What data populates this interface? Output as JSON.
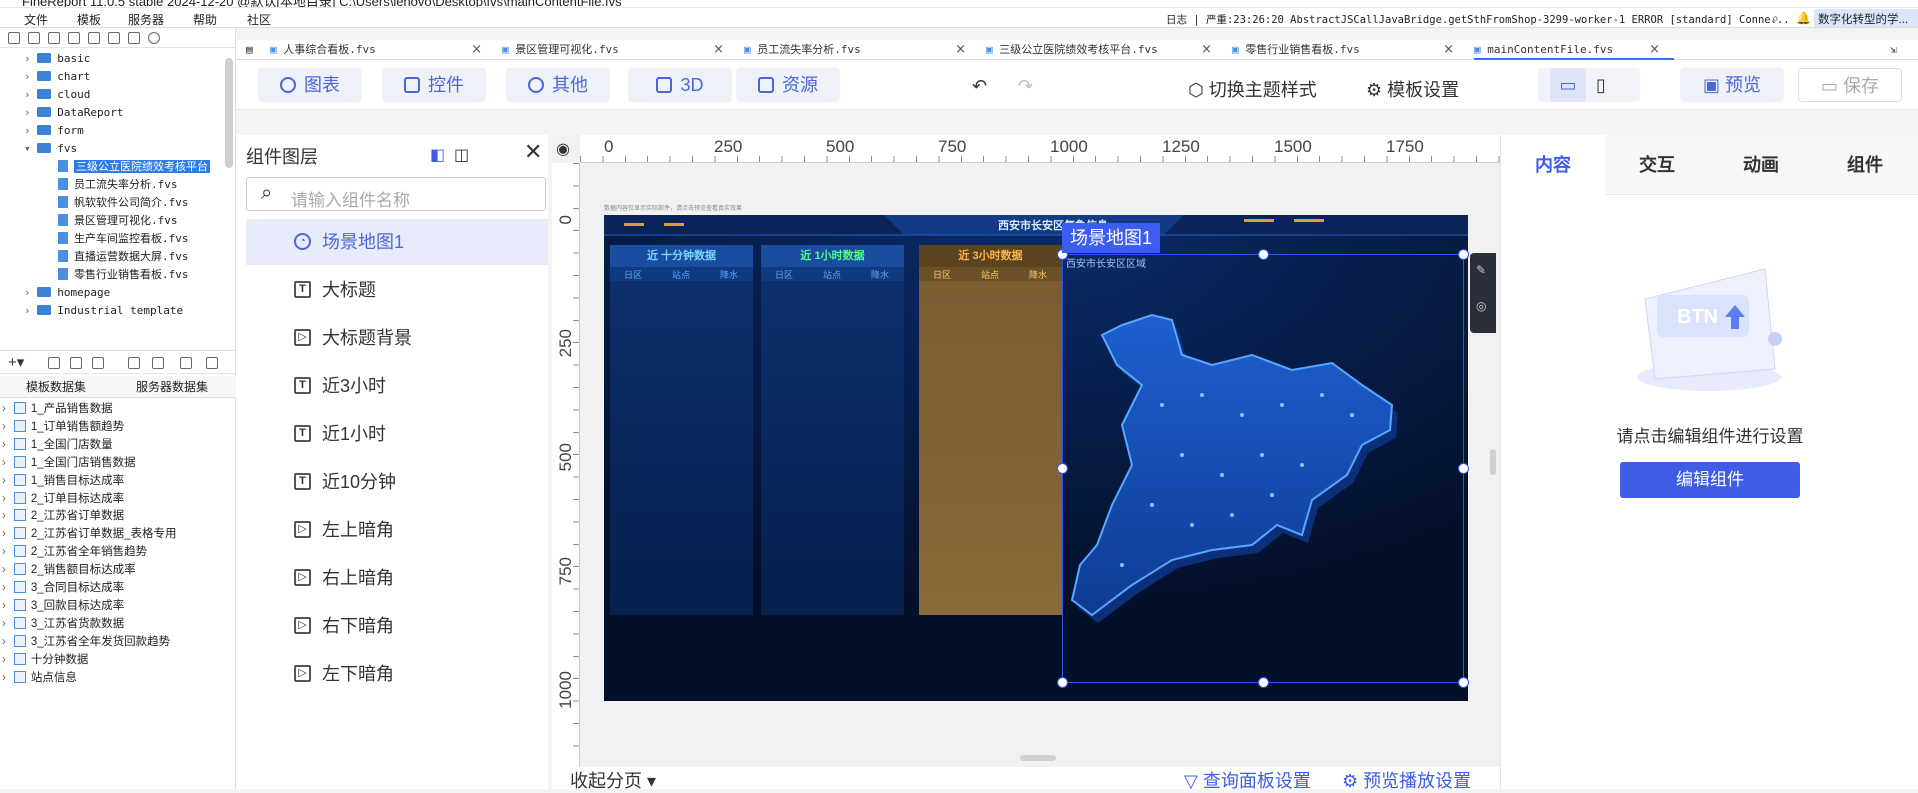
{
  "window": {
    "title": "FineReport 11.0.5 stable 2024-12-20 @默认[本地目录]    C:\\Users\\lenovo\\Desktop\\fvs\\mainContentFile.fvs"
  },
  "menu": {
    "items": [
      "文件",
      "模板",
      "服务器",
      "帮助",
      "社区"
    ],
    "log": "日志 | 严重:23:26:20 AbstractJSCallJavaBridge.getSthFromShop-3299-worker-1 ERROR [standard] Conne...",
    "tag": "数字化转型的学..."
  },
  "tree": {
    "items": [
      {
        "label": "basic",
        "type": "folder",
        "level": 1
      },
      {
        "label": "chart",
        "type": "folder",
        "level": 1
      },
      {
        "label": "cloud",
        "type": "folder",
        "level": 1
      },
      {
        "label": "DataReport",
        "type": "folder",
        "level": 1
      },
      {
        "label": "form",
        "type": "folder",
        "level": 1
      },
      {
        "label": "fvs",
        "type": "folder",
        "level": 1
      },
      {
        "label": "三级公立医院绩效考核平台",
        "type": "file",
        "level": 2,
        "selected": true
      },
      {
        "label": "员工流失率分析.fvs",
        "type": "file",
        "level": 2
      },
      {
        "label": "帆软软件公司简介.fvs",
        "type": "file",
        "level": 2
      },
      {
        "label": "景区管理可视化.fvs",
        "type": "file",
        "level": 2
      },
      {
        "label": "生产车间监控看板.fvs",
        "type": "file",
        "level": 2
      },
      {
        "label": "直播运营数据大屏.fvs",
        "type": "file",
        "level": 2
      },
      {
        "label": "零售行业销售看板.fvs",
        "type": "file",
        "level": 2
      },
      {
        "label": "homepage",
        "type": "folder",
        "level": 1
      },
      {
        "label": "Industrial template",
        "type": "folder",
        "level": 1
      }
    ]
  },
  "datasets": {
    "tabs": [
      "模板数据集",
      "服务器数据集"
    ],
    "items": [
      "1_产品销售数据",
      "1_订单销售额趋势",
      "1_全国门店数量",
      "1_全国门店销售数据",
      "1_销售目标达成率",
      "2_订单目标达成率",
      "2_江苏省订单数据",
      "2_江苏省订单数据_表格专用",
      "2_江苏省全年销售趋势",
      "2_销售额目标达成率",
      "3_合同目标达成率",
      "3_回款目标达成率",
      "3_江苏省货款数据",
      "3_江苏省全年发货回款趋势",
      "十分钟数据",
      "站点信息"
    ]
  },
  "doctabs": [
    {
      "label": "人事综合看板.fvs"
    },
    {
      "label": "景区管理可视化.fvs"
    },
    {
      "label": "员工流失率分析.fvs"
    },
    {
      "label": "三级公立医院绩效考核平台.fvs"
    },
    {
      "label": "零售行业销售看板.fvs"
    },
    {
      "label": "mainContentFile.fvs",
      "active": true
    }
  ],
  "toolbar": {
    "chart": "图表",
    "widget": "控件",
    "other": "其他",
    "three_d": "3D",
    "resource": "资源",
    "switch_theme": "切换主题样式",
    "template_settings": "模板设置",
    "preview": "预览",
    "save": "保存"
  },
  "layers": {
    "title": "组件图层",
    "search_placeholder": "请输入组件名称",
    "items": [
      "场景地图1",
      "大标题",
      "大标题背景",
      "近3小时",
      "近1小时",
      "近10分钟",
      "左上暗角",
      "右上暗角",
      "右下暗角",
      "左下暗角"
    ]
  },
  "ruler": {
    "h": [
      "0",
      "250",
      "500",
      "750",
      "1000",
      "1250",
      "1500",
      "1750"
    ],
    "v": [
      "0",
      "250",
      "500",
      "750",
      "1000"
    ]
  },
  "canvas": {
    "title": "西安市长安区气象信息",
    "map_sub": "西安市长安区区域",
    "tiny": "数据内容仅显示实际部件，请点击预览查看真实效果",
    "panels": [
      {
        "title": "近 十分钟数据",
        "cols": [
          "日区",
          "站点",
          "降水"
        ],
        "color": "#1a4da0",
        "text": "#7ad6ff"
      },
      {
        "title": "近 1小时数据",
        "cols": [
          "日区",
          "站点",
          "降水"
        ],
        "color": "#1a4da0",
        "text": "#4dff8a"
      },
      {
        "title": "近 3小时数据",
        "cols": [
          "日区",
          "站点",
          "降水"
        ],
        "color": "#8a6a3a",
        "text": "#ffb347"
      }
    ]
  },
  "selection": {
    "label": "场景地图1"
  },
  "right": {
    "tabs": [
      "内容",
      "交互",
      "动画",
      "组件"
    ],
    "hint": "请点击编辑组件进行设置",
    "edit_button": "编辑组件",
    "illustration_text": "BTN"
  },
  "bottom": {
    "collapse": "收起分页",
    "query": "查询面板设置",
    "play": "预览播放设置"
  }
}
